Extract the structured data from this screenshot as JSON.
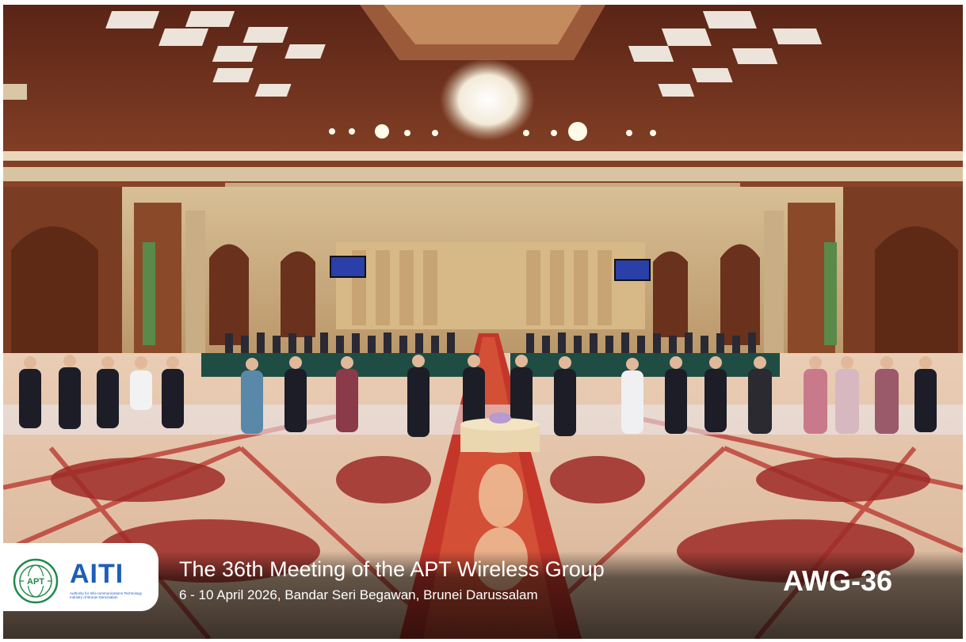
{
  "photo": {
    "subject": "conference-hall-group-photo",
    "colors": {
      "ceiling": "#7a3a22",
      "carpet": "#b8322a",
      "carpet_light": "#f0d9c4",
      "walls": "#c9a77a",
      "table_cloth": "#1f4d44"
    }
  },
  "branding": {
    "apt_logo_text": "APT",
    "aiti_name": "AITI",
    "aiti_tagline": "Authority for Info-communications Technology Industry of Brunei Darussalam"
  },
  "event": {
    "title": "The 36th Meeting of the APT Wireless Group",
    "details": "6 - 10 April 2026, Bandar Seri Begawan, Brunei Darussalam",
    "code": "AWG-36"
  }
}
